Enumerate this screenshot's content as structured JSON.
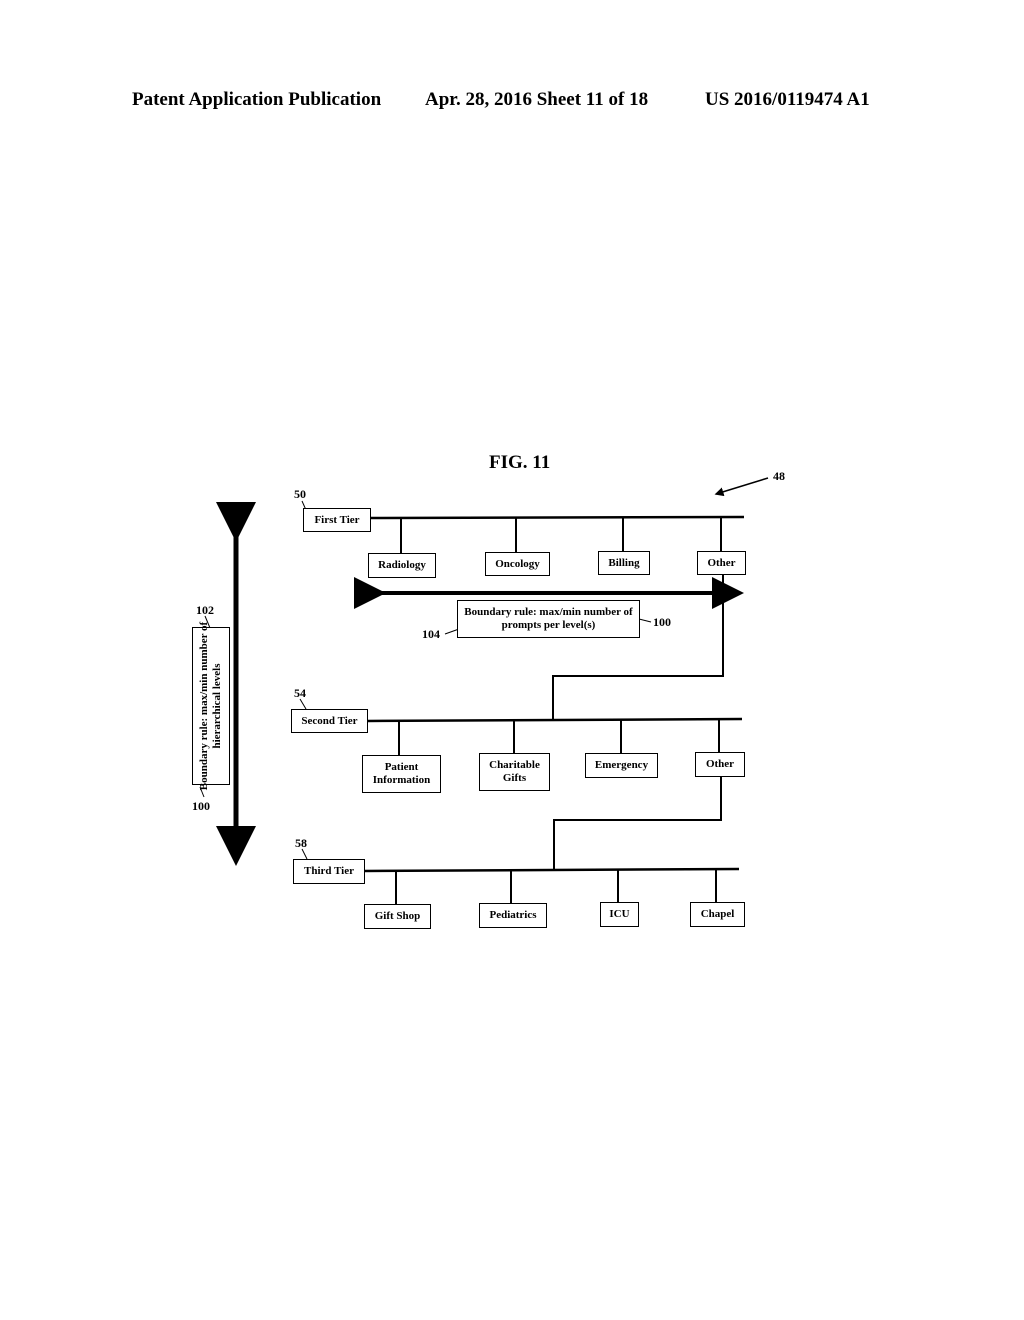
{
  "header": {
    "publication": "Patent Application Publication",
    "date_sheet": "Apr. 28, 2016  Sheet 11 of 18",
    "patent_number": "US 2016/0119474 A1"
  },
  "figure": {
    "title": "FIG. 11",
    "ref_system": "48",
    "tiers": [
      {
        "ref": "50",
        "label": "First Tier",
        "options": [
          "Radiology",
          "Oncology",
          "Billing",
          "Other"
        ]
      },
      {
        "ref": "54",
        "label": "Second Tier",
        "options": [
          "Patient Information",
          "Charitable Gifts",
          "Emergency",
          "Other"
        ]
      },
      {
        "ref": "58",
        "label": "Third Tier",
        "options": [
          "Gift Shop",
          "Pediatrics",
          "ICU",
          "Chapel"
        ]
      }
    ],
    "horizontal_rule": {
      "text": "Boundary rule: max/min number of prompts per level(s)",
      "ref_box": "104",
      "ref_rule": "100"
    },
    "vertical_rule": {
      "text": "Boundary rule: max/min number of hierarchical levels",
      "ref_box": "102",
      "ref_rule": "100"
    }
  }
}
